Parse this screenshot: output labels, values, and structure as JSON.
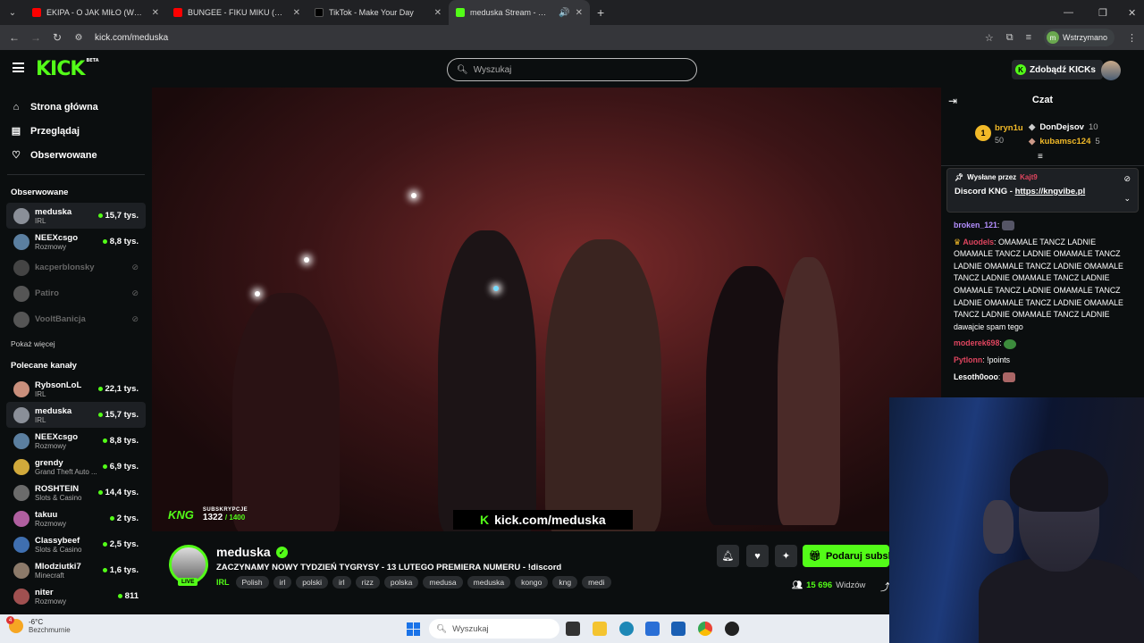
{
  "browser": {
    "tabs": [
      {
        "title": "EKIPA - O JAK MIŁO (Wujas, Mi",
        "color": "#ff0000"
      },
      {
        "title": "BUNGEE - FIKU MIKU (Official V",
        "color": "#ff0000"
      },
      {
        "title": "TikTok - Make Your Day",
        "color": "#000000"
      },
      {
        "title": "meduska Stream - Watch Li",
        "color": "#53fc18"
      }
    ],
    "url": "kick.com/meduska",
    "profile_status": "Wstrzymano"
  },
  "header": {
    "logo": "KICK",
    "logo_badge": "BETA",
    "search_placeholder": "Wyszukaj",
    "kicks_button": "Zdobądź KICKs"
  },
  "sidebar": {
    "nav": [
      {
        "label": "Strona główna",
        "icon": "home-icon"
      },
      {
        "label": "Przeglądaj",
        "icon": "browse-icon"
      },
      {
        "label": "Obserwowane",
        "icon": "heart-icon"
      }
    ],
    "followed_heading": "Obserwowane",
    "followed": [
      {
        "name": "meduska",
        "category": "IRL",
        "viewers": "15,7 tys.",
        "live": true,
        "selected": true,
        "color": "#8a8f98"
      },
      {
        "name": "NEEXcsgo",
        "category": "Rozmowy",
        "viewers": "8,8 tys.",
        "live": true,
        "selected": false,
        "color": "#5b7fa0"
      },
      {
        "name": "kacperblonsky",
        "category": "",
        "viewers": "",
        "live": false,
        "selected": false,
        "color": "#444"
      },
      {
        "name": "Patiro",
        "category": "",
        "viewers": "",
        "live": false,
        "selected": false,
        "color": "#555"
      },
      {
        "name": "VooltBanicja",
        "category": "",
        "viewers": "",
        "live": false,
        "selected": false,
        "color": "#555"
      }
    ],
    "show_more": "Pokaż więcej",
    "recommended_heading": "Polecane kanały",
    "recommended": [
      {
        "name": "RybsonLoL",
        "category": "IRL",
        "viewers": "22,1 tys.",
        "selected": false,
        "color": "#c98f7c"
      },
      {
        "name": "meduska",
        "category": "IRL",
        "viewers": "15,7 tys.",
        "selected": true,
        "color": "#8a8f98"
      },
      {
        "name": "NEEXcsgo",
        "category": "Rozmowy",
        "viewers": "8,8 tys.",
        "selected": false,
        "color": "#5b7fa0"
      },
      {
        "name": "grendy",
        "category": "Grand Theft Auto ...",
        "viewers": "6,9 tys.",
        "selected": false,
        "color": "#d1a93b"
      },
      {
        "name": "ROSHTEIN",
        "category": "Slots & Casino",
        "viewers": "14,4 tys.",
        "selected": false,
        "color": "#6b6b6b"
      },
      {
        "name": "takuu",
        "category": "Rozmowy",
        "viewers": "2 tys.",
        "selected": false,
        "color": "#b05fa0"
      },
      {
        "name": "Classybeef",
        "category": "Slots & Casino",
        "viewers": "2,5 tys.",
        "selected": false,
        "color": "#3f6fb0"
      },
      {
        "name": "Mlodziutki7",
        "category": "Minecraft",
        "viewers": "1,6 tys.",
        "selected": false,
        "color": "#8c7a6a"
      },
      {
        "name": "niter",
        "category": "Rozmowy",
        "viewers": "811",
        "selected": false,
        "color": "#a05050"
      }
    ]
  },
  "video": {
    "subs_label": "SUBSKRYPCJE",
    "subs_count": "1322",
    "subs_goal": "/ 1400",
    "kng": "KNG",
    "overlay_url": "kick.com/meduska"
  },
  "stream": {
    "live_badge": "LIVE",
    "name": "meduska",
    "title": "ZACZYNAMY NOWY TYDZIEŃ TYGRYSY - 13 LUTEGO PREMIERA NUMERU - !discord",
    "category": "IRL",
    "tags": [
      "Polish",
      "irl",
      "polski",
      "irl",
      "rizz",
      "polska",
      "medusa",
      "meduska",
      "kongo",
      "kng",
      "medi"
    ],
    "gift_button": "Podaruj subsk",
    "viewers": "15 696",
    "viewers_label": "Widzów"
  },
  "chat": {
    "title": "Czat",
    "leaderboard": {
      "first": {
        "name": "bryn1u",
        "points": "50",
        "rank": "1"
      },
      "second": {
        "name": "DonDejsov",
        "points": "10"
      },
      "third": {
        "name": "kubamsc124",
        "points": "5"
      }
    },
    "pinned": {
      "sent_by_label": "Wysłane przez",
      "sent_by_user": "Kajt9",
      "message_prefix": "Discord KNG - ",
      "message_link": "https://kngvibe.pl"
    },
    "messages": [
      {
        "user": "broken_121",
        "text": ""
      },
      {
        "user": "Auodels",
        "text": "OMAMALE TANCZ LADNIE OMAMALE TANCZ LADNIE OMAMALE TANCZ LADNIE OMAMALE TANCZ LADNIE OMAMALE TANCZ LADNIE OMAMALE TANCZ LADNIE OMAMALE TANCZ LADNIE OMAMALE TANCZ LADNIE OMAMALE TANCZ LADNIE OMAMALE TANCZ LADNIE OMAMALE TANCZ LADNIE dawajcie spam tego"
      },
      {
        "user": "moderek698",
        "text": ""
      },
      {
        "user": "Pytlonn",
        "text": "!points"
      },
      {
        "user": "Lesoth0ooo",
        "text": ""
      }
    ]
  },
  "taskbar": {
    "temperature": "-6°C",
    "weather": "Bezchmurnie",
    "weather_badge": "4",
    "search": "Wyszukaj"
  }
}
